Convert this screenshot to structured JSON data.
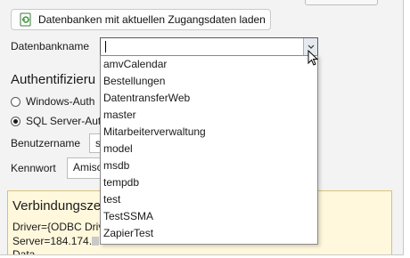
{
  "toolbar": {
    "load_button_label": "Datenbanken mit aktuellen Zugangsdaten laden",
    "load_button_icon": "refresh-database-icon"
  },
  "database": {
    "label": "Datenbankname",
    "value": "",
    "options": [
      "amvCalendar",
      "Bestellungen",
      "DatentransferWeb",
      "master",
      "Mitarbeiterverwaltung",
      "model",
      "msdb",
      "tempdb",
      "test",
      "TestSSMA",
      "ZapierTest"
    ]
  },
  "auth": {
    "heading": "Authentifizieru",
    "options": [
      {
        "label": "Windows-Auth",
        "checked": false
      },
      {
        "label": "SQL Server-Aut",
        "checked": true
      }
    ],
    "username_label": "Benutzername",
    "username_value": "s",
    "password_label": "Kennwort",
    "password_value": "Amisc"
  },
  "connection": {
    "heading": "Verbindungsze",
    "line1": "Driver={ODBC Driv",
    "line2": "Server=184.174.",
    "line3": "Data"
  },
  "colors": {
    "window_bg": "#f3f3f3",
    "conn_box_bg": "#fff8dc",
    "conn_box_border": "#d8c07a"
  }
}
